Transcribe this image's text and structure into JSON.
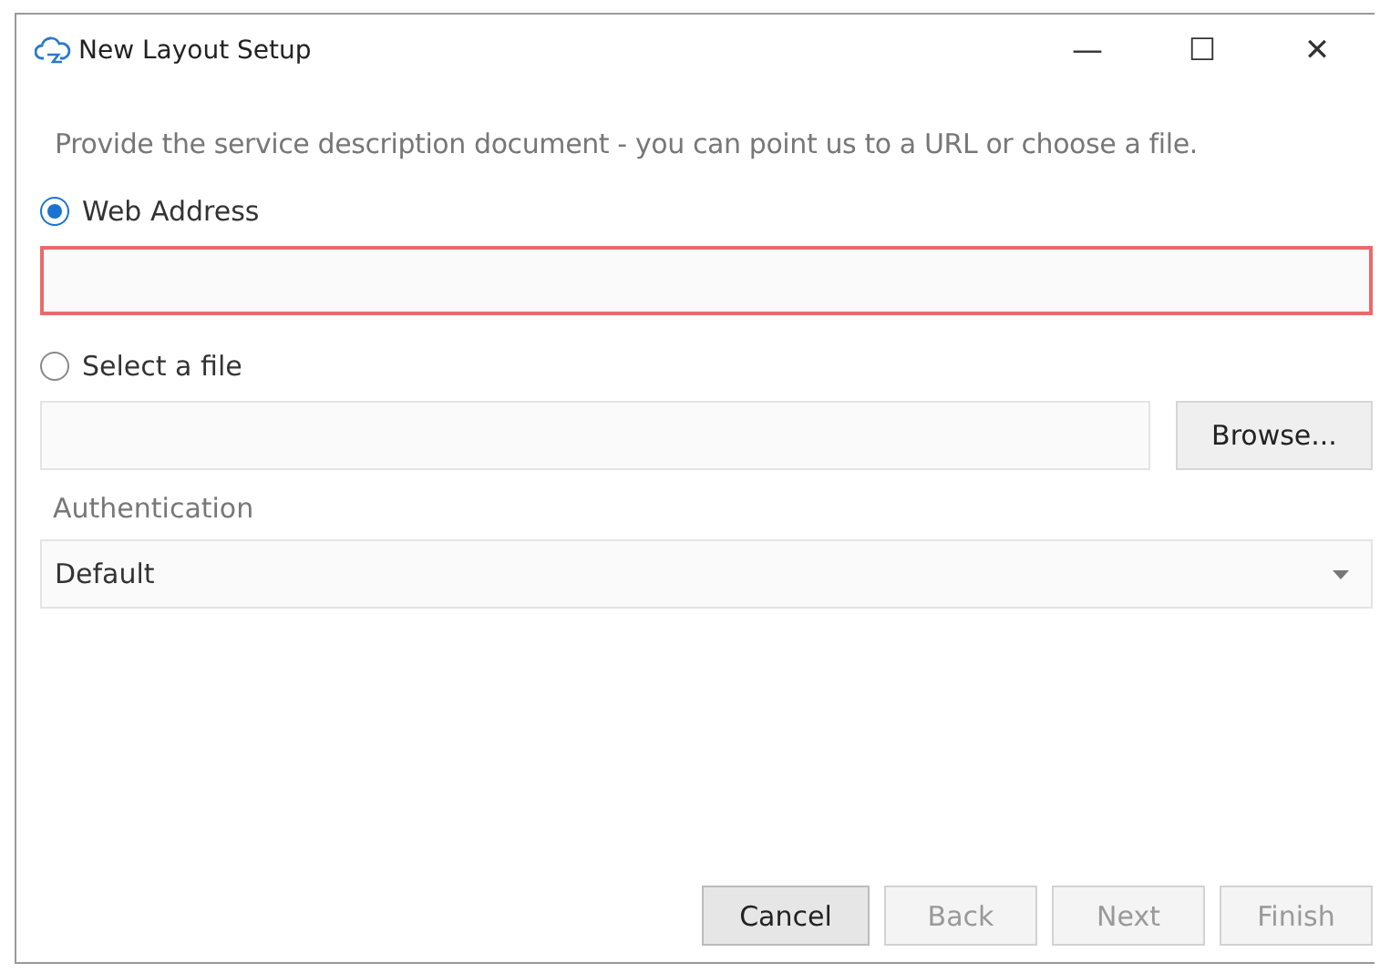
{
  "window": {
    "title": "New Layout Setup",
    "controls": [
      "—",
      "☐",
      "✕"
    ]
  },
  "description": "Provide the service description document - you can point us to a URL or choose a file.",
  "sources": [
    {
      "label": "Web Address",
      "selected": true,
      "field": {
        "invalid": true
      }
    },
    {
      "label": "Select a file",
      "selected": false,
      "field": {
        "invalid": false
      },
      "button": "Browse..."
    }
  ],
  "authentication": {
    "label": "Authentication",
    "value": "Default"
  },
  "buttons": [
    {
      "label": "Cancel",
      "disabled": false
    },
    {
      "label": "Back",
      "disabled": true
    },
    {
      "label": "Next",
      "disabled": true
    },
    {
      "label": "Finish",
      "disabled": true
    }
  ]
}
